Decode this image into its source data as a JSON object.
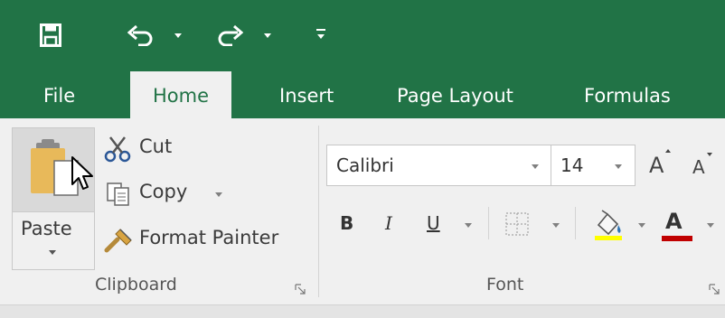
{
  "quick_access": {
    "icons": [
      "save-icon",
      "undo-icon",
      "redo-icon",
      "customize-qat-icon"
    ]
  },
  "tabs": [
    {
      "label": "File",
      "active": false
    },
    {
      "label": "Home",
      "active": true
    },
    {
      "label": "Insert",
      "active": false
    },
    {
      "label": "Page Layout",
      "active": false
    },
    {
      "label": "Formulas",
      "active": false
    }
  ],
  "clipboard": {
    "paste_label": "Paste",
    "cut_label": "Cut",
    "copy_label": "Copy",
    "format_painter_label": "Format Painter",
    "group_label": "Clipboard"
  },
  "font": {
    "font_name": "Calibri",
    "font_size": "14",
    "grow_font_label": "A",
    "shrink_font_label": "A",
    "bold_label": "B",
    "italic_label": "I",
    "underline_label": "U",
    "font_color_label": "A",
    "group_label": "Font"
  },
  "colors": {
    "brand_green": "#217346",
    "highlight_yellow": "#ffff00",
    "font_color_red": "#c00000"
  }
}
